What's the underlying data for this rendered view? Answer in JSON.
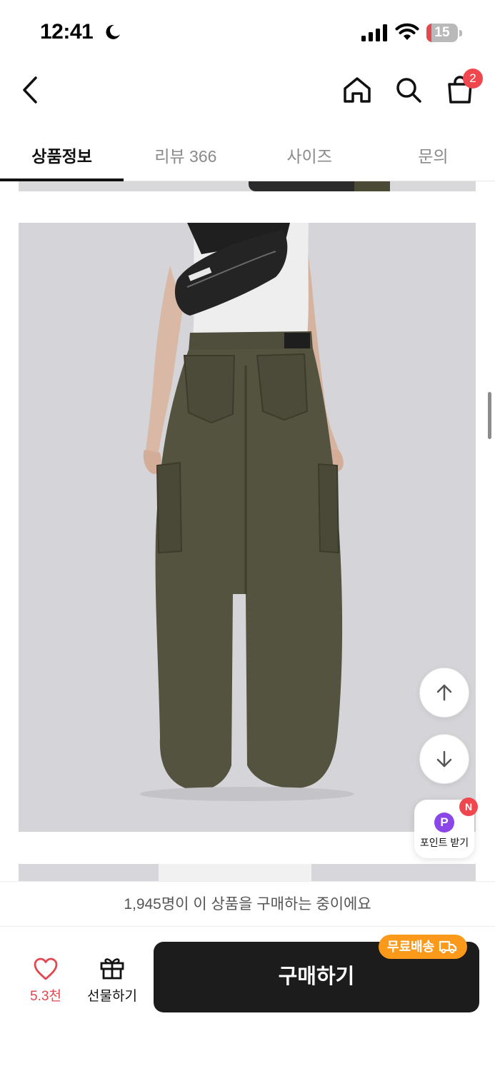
{
  "status_bar": {
    "time": "12:41",
    "battery_percent": "15",
    "battery_level": 0.15
  },
  "header": {
    "back_icon": "chevron-left-icon",
    "home_icon": "home-icon",
    "search_icon": "search-icon",
    "cart_icon": "shopping-bag-icon",
    "cart_count": "2"
  },
  "tabs": [
    {
      "label": "상품정보",
      "active": true
    },
    {
      "label": "리뷰 366",
      "active": false
    },
    {
      "label": "사이즈",
      "active": false
    },
    {
      "label": "문의",
      "active": false
    }
  ],
  "floating": {
    "scroll_up_icon": "arrow-up-icon",
    "scroll_down_icon": "arrow-down-icon",
    "point_icon_text": "P",
    "point_label": "포인트 받기",
    "point_badge": "N"
  },
  "bottom_bar": {
    "buyers_text": "1,945명이 이 상품을 구매하는 중이에요",
    "like_count": "5.3천",
    "gift_label": "선물하기",
    "buy_label": "구매하기",
    "free_shipping_label": "무료배송"
  },
  "colors": {
    "accent_red": "#f0474f",
    "buy_button": "#1c1c1c",
    "free_shipping": "#fb9a1a",
    "point_purple": "#8b46e8"
  }
}
